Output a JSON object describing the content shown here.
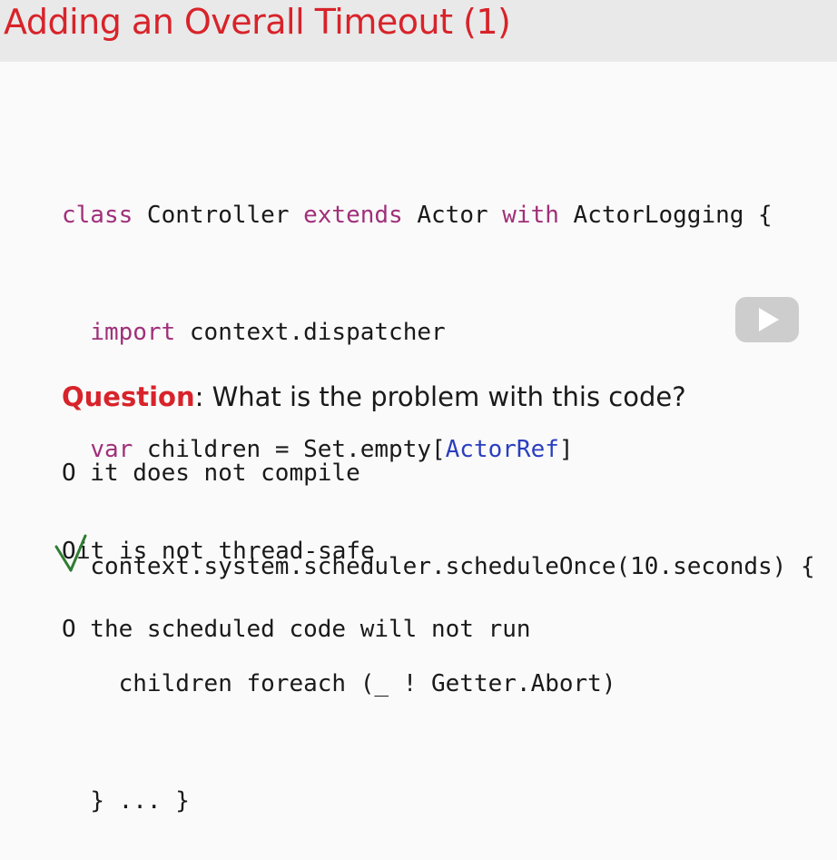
{
  "slide": {
    "title": "Adding an Overall Timeout (1)"
  },
  "code": {
    "l1": {
      "a": "class",
      "b": " Controller ",
      "c": "extends",
      "d": " Actor ",
      "e": "with",
      "f": " ActorLogging {"
    },
    "l2": {
      "a": "import",
      "b": " context.dispatcher"
    },
    "l3": {
      "a": "var",
      "b": " children = Set.empty[",
      "c": "ActorRef",
      "d": "]"
    },
    "l4": {
      "a": "context.system.scheduler.scheduleOnce(10.seconds) {"
    },
    "l5": {
      "a": "children foreach (_ ! Getter.Abort)"
    },
    "l6": {
      "a": "} ... }"
    }
  },
  "question": {
    "label": "Question",
    "text": ": What is the problem with this code?"
  },
  "options": [
    {
      "marker": "O",
      "text": " it does not compile",
      "checked": false
    },
    {
      "marker": "O",
      "text": "it is not thread-safe",
      "checked": true
    },
    {
      "marker": "O",
      "text": " the scheduled code will not run",
      "checked": false
    }
  ],
  "colors": {
    "title": "#d8232a",
    "keyword": "#a0307a",
    "type": "#2a3fbf",
    "checkmark": "#2e7d32"
  },
  "icons": {
    "play": "play-icon",
    "check": "check-mark-icon"
  }
}
